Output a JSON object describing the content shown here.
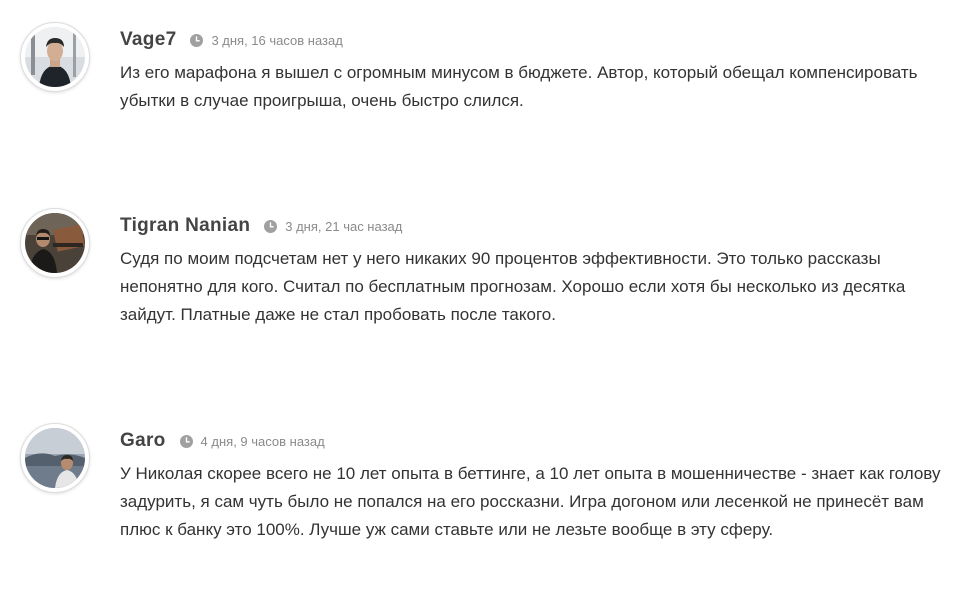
{
  "comments": [
    {
      "author": "Vage7",
      "time": "3 дня, 16 часов назад",
      "text": "Из его марафона я вышел с огромным минусом в бюджете. Автор, который обещал компенсировать убытки в случае проигрыша, очень быстро слился."
    },
    {
      "author": "Tigran Nanian",
      "time": "3 дня, 21 час назад",
      "text": "Судя по моим подсчетам нет у него никаких 90 процентов эффективности. Это только рассказы непонятно для кого. Считал по бесплатным прогнозам. Хорошо если хотя бы несколько из десятка зайдут. Платные даже не стал пробовать после такого."
    },
    {
      "author": "Garo",
      "time": "4 дня, 9 часов назад",
      "text": "У Николая скорее всего не 10 лет опыта в беттинге, а 10 лет опыта в мошенничестве - знает как голову задурить, я сам чуть было не попался на его россказни. Игра догоном или лесенкой не принесёт вам плюс к банку это 100%. Лучше уж сами ставьте или не лезьте вообще в эту сферу."
    }
  ],
  "colors": {
    "author": "#444444",
    "time": "#8a8a8a",
    "text": "#333333",
    "clock_icon": "#a0a0a0"
  },
  "icons": {
    "time": "clock-icon"
  }
}
